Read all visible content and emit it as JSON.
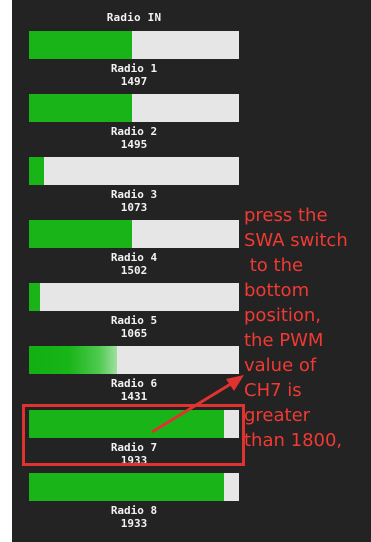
{
  "panel": {
    "title": "Radio IN"
  },
  "channels": [
    {
      "label": "Radio 1",
      "value": "1497",
      "fill": 0.49
    },
    {
      "label": "Radio 2",
      "value": "1495",
      "fill": 0.49
    },
    {
      "label": "Radio 3",
      "value": "1073",
      "fill": 0.07
    },
    {
      "label": "Radio 4",
      "value": "1502",
      "fill": 0.49
    },
    {
      "label": "Radio 5",
      "value": "1065",
      "fill": 0.05
    },
    {
      "label": "Radio 6",
      "value": "1431",
      "fill": 0.42
    },
    {
      "label": "Radio 7",
      "value": "1933",
      "fill": 0.93
    },
    {
      "label": "Radio 8",
      "value": "1933",
      "fill": 0.93
    }
  ],
  "annotation": {
    "text": "press the\nSWA switch\n to the\nbottom\nposition,\nthe PWM\nvalue of\nCH7 is\ngreater\nthan 1800,",
    "highlighted_channel": "Radio 7"
  },
  "colors": {
    "panel_bg": "#232323",
    "track": "#e6e6e6",
    "fill": "#18b418",
    "text": "#f2f2f2",
    "annotation": "#f03a33"
  }
}
